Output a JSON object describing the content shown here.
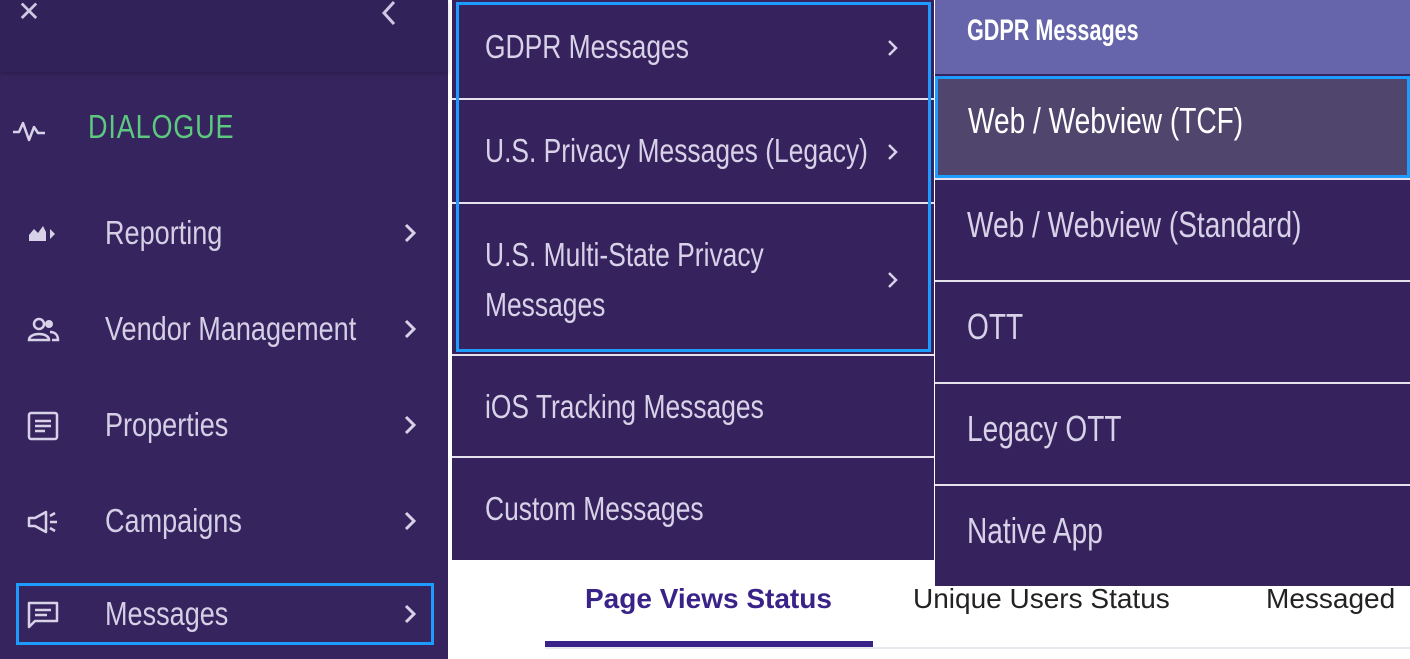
{
  "sidebar": {
    "close_icon": "close-icon",
    "collapse_icon": "chevron-left-icon",
    "section": {
      "label": "DIALOGUE",
      "icon": "pulse-icon",
      "color": "#5cc97e"
    },
    "items": [
      {
        "label": "Reporting",
        "icon": "area-chart-icon"
      },
      {
        "label": "Vendor Management",
        "icon": "people-icon"
      },
      {
        "label": "Properties",
        "icon": "document-icon"
      },
      {
        "label": "Campaigns",
        "icon": "megaphone-icon"
      },
      {
        "label": "Messages",
        "icon": "message-icon",
        "active": true
      }
    ]
  },
  "flyout": {
    "items": [
      {
        "label": "GDPR Messages",
        "has_submenu": true
      },
      {
        "label": "U.S. Privacy Messages (Legacy)",
        "has_submenu": true
      },
      {
        "label_line1": "U.S. Multi-State Privacy",
        "label_line2": "Messages",
        "has_submenu": true
      },
      {
        "label": "iOS Tracking Messages",
        "has_submenu": false
      },
      {
        "label": "Custom Messages",
        "has_submenu": false
      }
    ]
  },
  "submenu": {
    "header": "GDPR Messages",
    "items": [
      {
        "label": "Web / Webview (TCF)",
        "selected": true
      },
      {
        "label": "Web / Webview (Standard)"
      },
      {
        "label": "OTT"
      },
      {
        "label": "Legacy OTT"
      },
      {
        "label": "Native App"
      }
    ]
  },
  "tabs": [
    {
      "label": "Page Views Status",
      "active": true
    },
    {
      "label": "Unique Users Status"
    },
    {
      "label": "Messaged"
    }
  ],
  "colors": {
    "sidebar_bg": "#35245e",
    "menu_bg": "#36235e",
    "submenu_header_bg": "#6665ab",
    "highlight_border": "#1e9bff",
    "active_tab": "#3a2388"
  }
}
